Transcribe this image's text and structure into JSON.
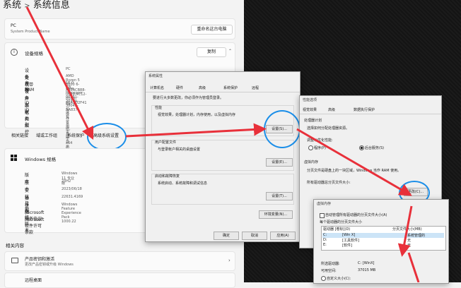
{
  "settings": {
    "breadcrumb_parent": "系统",
    "breadcrumb_sep": ">",
    "breadcrumb_current": "系统信息",
    "device_short_name": "PC",
    "device_model": "System Product Name",
    "rename_button": "重命名这台电脑",
    "device_spec_title": "设备规格",
    "copy_button": "复制",
    "specs": [
      {
        "label": "设备名称",
        "value": "PC"
      },
      {
        "label": "处理器",
        "value": "AMD Ryzen 5 3600 6-Core Processor"
      },
      {
        "label": "机带 RAM",
        "value": "16.0 GB"
      },
      {
        "label": "设备 ID",
        "value": "A3EACB88-0669-4C12-816D-8CA2D2F41"
      },
      {
        "label": "产品 ID",
        "value": "00331-20350-38045-AA837"
      },
      {
        "label": "系统类型",
        "value": "64 位操作系统, 基于 x64 的处理器"
      },
      {
        "label": "笔和触控",
        "value": "没有可用于此显示器的笔或触控输入"
      }
    ],
    "related_links": [
      "相关链接",
      "域或工作组",
      "系统保护",
      "高级系统设置"
    ],
    "win_spec_title": "Windows 规格",
    "win_specs": [
      {
        "label": "版本",
        "value": "Windows 11 专业版"
      },
      {
        "label": "版本",
        "value": "23H2"
      },
      {
        "label": "安装日期",
        "value": "2023/06/18"
      },
      {
        "label": "操作系统版本",
        "value": "22631.4169"
      },
      {
        "label": "体验",
        "value": "Windows Feature Experience Pack 1000.22"
      }
    ],
    "service_links": [
      "Microsoft 服务协议",
      "Microsoft 软件许可条款"
    ],
    "related_title": "相关内容",
    "product_key_title": "产品密钥和激活",
    "product_key_sub": "更改产品密钥或升级 Windows",
    "remote_desktop": "远程桌面"
  },
  "sysprops": {
    "title": "系统属性",
    "tabs": [
      "计算机名",
      "硬件",
      "高级",
      "系统保护",
      "远程"
    ],
    "admin_note": "要进行大多数更改，你必须作为管理员登录。",
    "perf_title": "性能",
    "perf_desc": "视觉效果，处理器计划，内存使用，以及虚拟内存",
    "settings_btn": "设置(S)...",
    "profile_title": "用户配置文件",
    "profile_desc": "与登录帐户相关的桌面设置",
    "settings_btn2": "设置(E)...",
    "startup_title": "启动和故障恢复",
    "startup_desc": "系统启动、系统故障和调试信息",
    "settings_btn3": "设置(T)...",
    "env_btn": "环境变量(N)...",
    "ok": "确定",
    "cancel": "取消",
    "apply": "应用(A)"
  },
  "perfopts": {
    "title": "性能选项",
    "tabs": [
      "视觉效果",
      "高级",
      "数据执行保护"
    ],
    "sched_title": "处理器计划",
    "sched_desc": "选择如何分配处理器资源。",
    "adjust_label": "调整以优化性能:",
    "opt_programs": "程序(P)",
    "opt_services": "后台服务(S)",
    "vm_title": "虚拟内存",
    "vm_desc": "分页文件是硬盘上的一块区域，Windows 当作 RAM 使用。",
    "vm_total": "所有驱动器总分页文件大小:",
    "change_btn": "更改(C)..."
  },
  "virtmem": {
    "title": "虚拟内存",
    "auto_manage": "自动管理所有驱动器的分页文件大小(A)",
    "each_drive": "每个驱动器的分页文件大小",
    "col_drive": "驱动器 [卷标](D)",
    "col_size": "分页文件大小(MB)",
    "drives": [
      {
        "drive": "C:",
        "label": "[Win X]",
        "size": "系统管理的"
      },
      {
        "drive": "D:",
        "label": "[工具软件]",
        "size": "无"
      },
      {
        "drive": "E:",
        "label": "[软件]",
        "size": "无"
      }
    ],
    "selected_label": "所选驱动器:",
    "selected_value": "C: [WinX]",
    "free_label": "可用空间:",
    "free_value": "37015 MB",
    "custom_size": "自定义大小(C):"
  }
}
